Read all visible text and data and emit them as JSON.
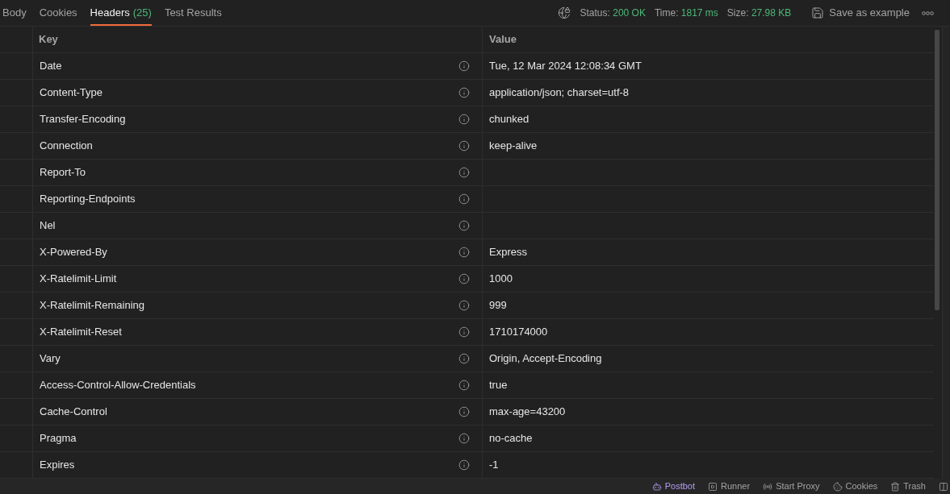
{
  "tabs": [
    {
      "label": "Body",
      "selected": false
    },
    {
      "label": "Cookies",
      "selected": false
    },
    {
      "label": "Headers",
      "count": "(25)",
      "selected": true
    },
    {
      "label": "Test Results",
      "selected": false
    }
  ],
  "response_meta": [
    {
      "label": "Status:",
      "value": "200 OK"
    },
    {
      "label": "Time:",
      "value": "1817 ms"
    },
    {
      "label": "Size:",
      "value": "27.98 KB"
    }
  ],
  "save_button": {
    "label": "Save as example"
  },
  "table": {
    "columns": [
      "Key",
      "Value"
    ],
    "rows": [
      {
        "key": "Date",
        "value": "Tue, 12 Mar 2024 12:08:34 GMT"
      },
      {
        "key": "Content-Type",
        "value": "application/json; charset=utf-8"
      },
      {
        "key": "Transfer-Encoding",
        "value": "chunked"
      },
      {
        "key": "Connection",
        "value": "keep-alive"
      },
      {
        "key": "Report-To"
      },
      {
        "key": "Reporting-Endpoints"
      },
      {
        "key": "Nel"
      },
      {
        "key": "X-Powered-By",
        "value": "Express"
      },
      {
        "key": "X-Ratelimit-Limit",
        "value": "1000"
      },
      {
        "key": "X-Ratelimit-Remaining",
        "value": "999"
      },
      {
        "key": "X-Ratelimit-Reset",
        "value": "1710174000"
      },
      {
        "key": "Vary",
        "value": "Origin, Accept-Encoding"
      },
      {
        "key": "Access-Control-Allow-Credentials",
        "value": "true"
      },
      {
        "key": "Cache-Control",
        "value": "max-age=43200"
      },
      {
        "key": "Pragma",
        "value": "no-cache"
      },
      {
        "key": "Expires",
        "value": "-1"
      }
    ]
  },
  "status_bar": [
    {
      "label": "Postbot",
      "kind": "postbot"
    },
    {
      "label": "Runner",
      "kind": "runner"
    },
    {
      "label": "Start Proxy",
      "kind": "proxy"
    },
    {
      "label": "Cookies",
      "kind": "cookies"
    },
    {
      "label": "Trash",
      "kind": "trash"
    }
  ]
}
